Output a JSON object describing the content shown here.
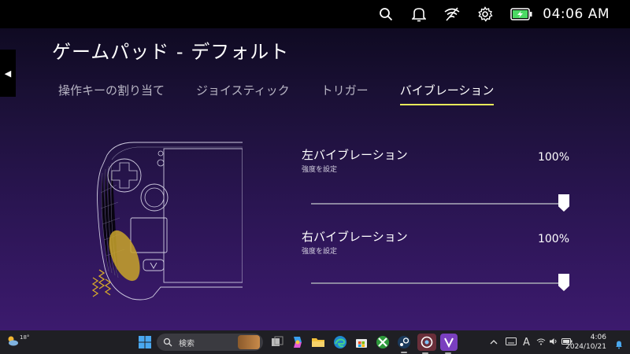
{
  "status_bar": {
    "time": "04:06 AM",
    "icons": [
      "search-icon",
      "bell-icon",
      "wifi-off-icon",
      "gear-icon",
      "battery-charging-icon"
    ],
    "battery_color": "#4cd964"
  },
  "page": {
    "title": "ゲームパッド - デフォルト",
    "back_glyph": "◀"
  },
  "tabs": [
    {
      "label": "操作キーの割り当て",
      "active": false
    },
    {
      "label": "ジョイスティック",
      "active": false
    },
    {
      "label": "トリガー",
      "active": false
    },
    {
      "label": "バイブレーション",
      "active": true
    }
  ],
  "accent_color": "#e8ea5a",
  "vibration": {
    "left": {
      "label": "左バイブレーション",
      "sub": "強度を設定",
      "value": "100%",
      "level": 1.0
    },
    "right": {
      "label": "右バイブレーション",
      "sub": "強度を設定",
      "value": "100%",
      "level": 1.0
    }
  },
  "taskbar": {
    "weather_temp": "18°",
    "search_placeholder": "検索",
    "apps": [
      "windows-start-icon",
      "search-box",
      "banner-icon",
      "task-view-icon",
      "copilot-icon",
      "file-explorer-icon",
      "edge-icon",
      "store-icon",
      "xbox-icon",
      "steam-icon",
      "app-icon",
      "legion-icon"
    ],
    "tray": {
      "ime": "A"
    },
    "clock_time": "4:06",
    "clock_date": "2024/10/21"
  }
}
